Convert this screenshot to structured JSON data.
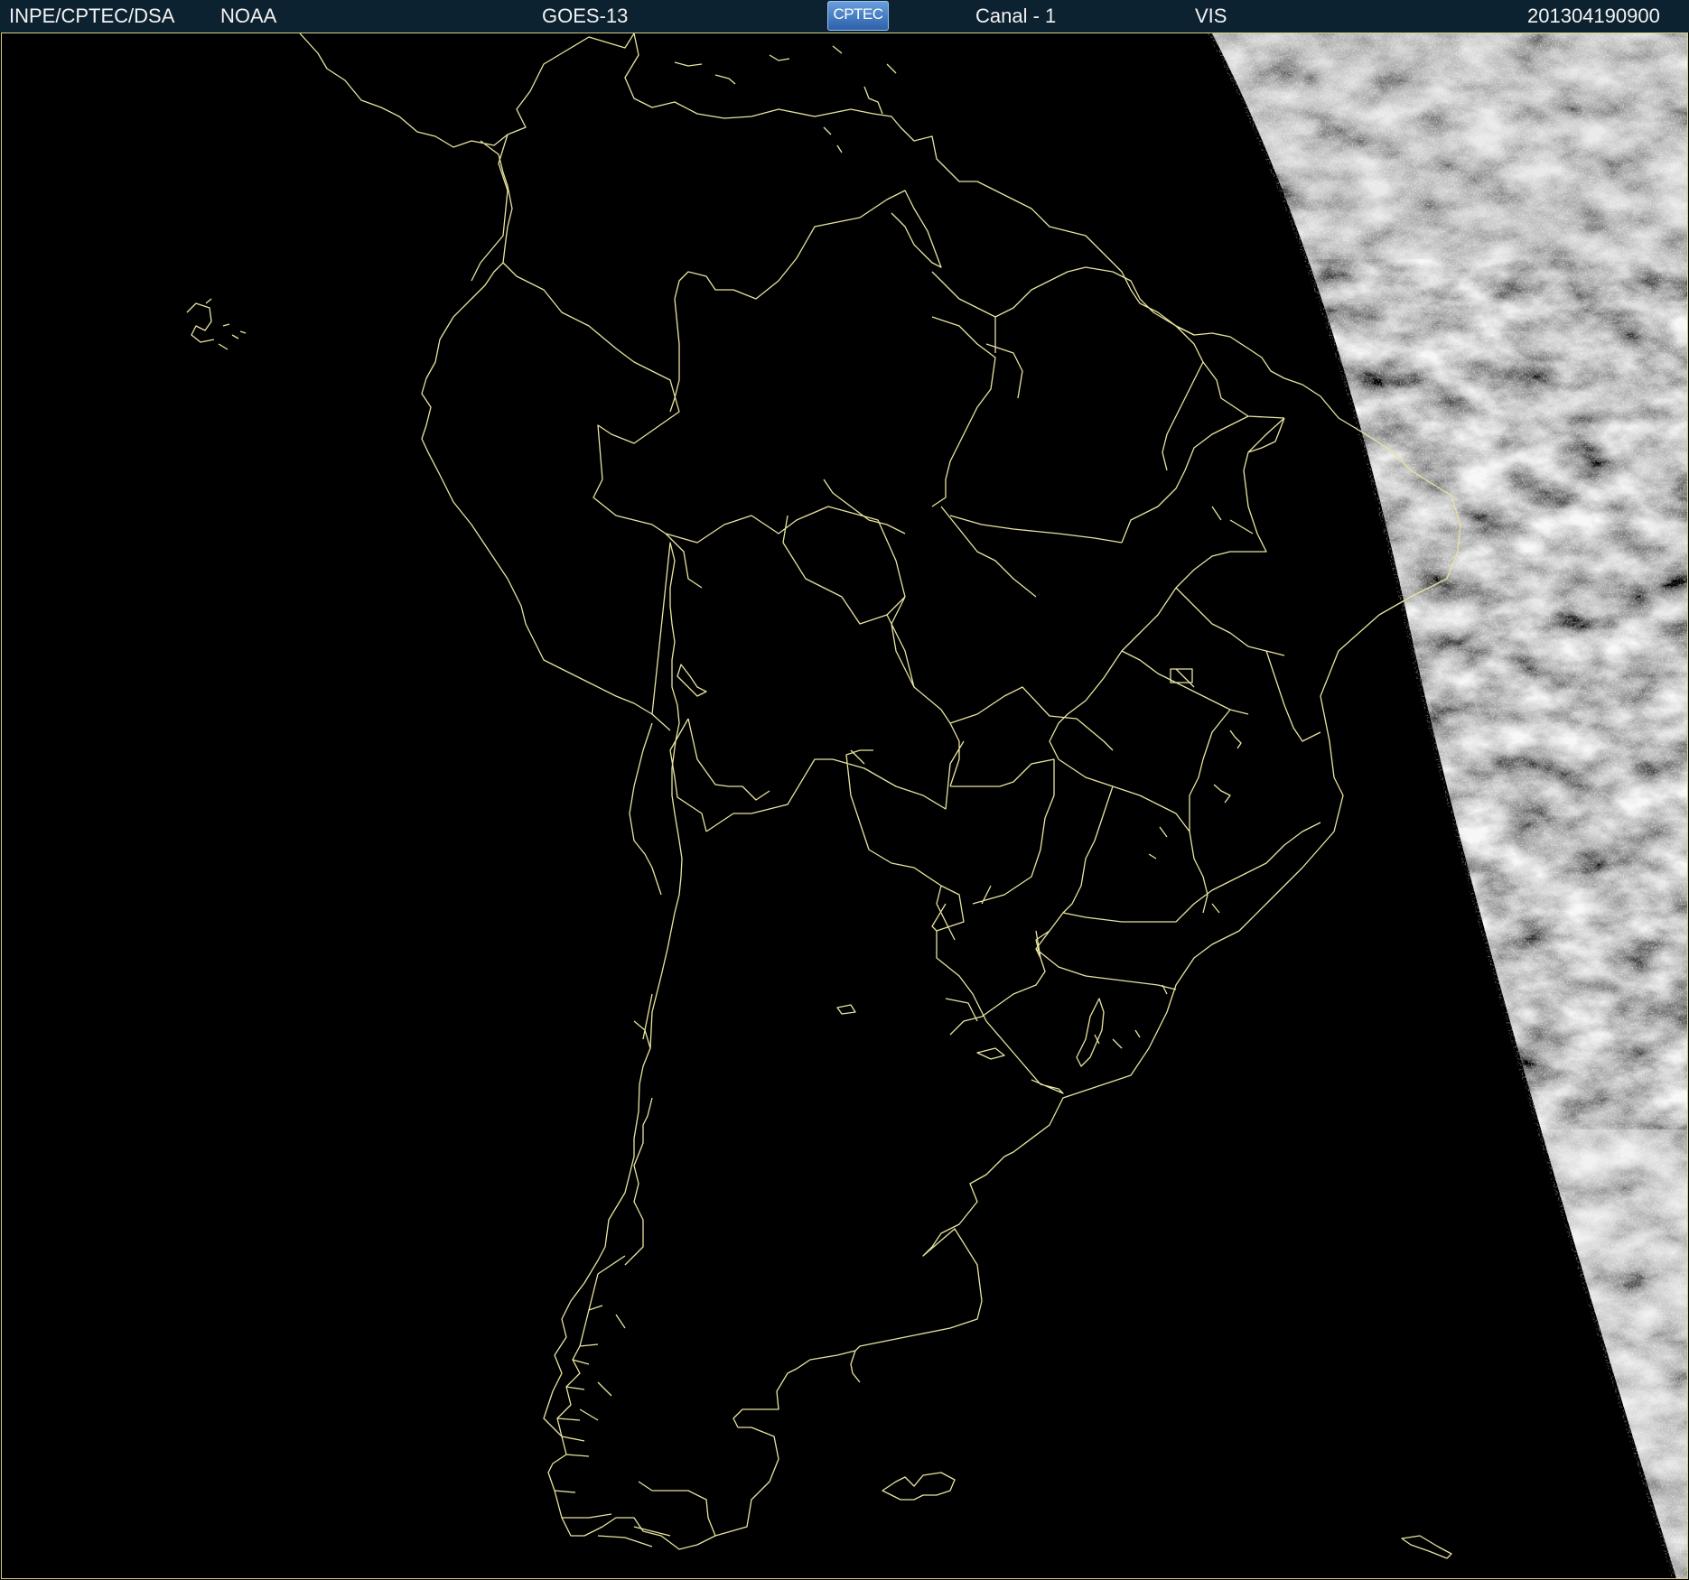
{
  "header": {
    "agency": "INPE/CPTEC/DSA",
    "source": "NOAA",
    "satellite": "GOES-13",
    "logo_text": "CPTEC",
    "channel": "Canal - 1",
    "band": "VIS",
    "timestamp": "201304190900"
  },
  "map": {
    "region": "South America",
    "boundary_color": "#e8e4a0",
    "background": "#000000",
    "cloud_colors": [
      "#f4f4f4",
      "#9a9a9a",
      "#4a4a4a"
    ],
    "illuminated_side": "right",
    "boundaries": [
      "coastlines",
      "country-borders",
      "brazil-state-borders"
    ]
  }
}
